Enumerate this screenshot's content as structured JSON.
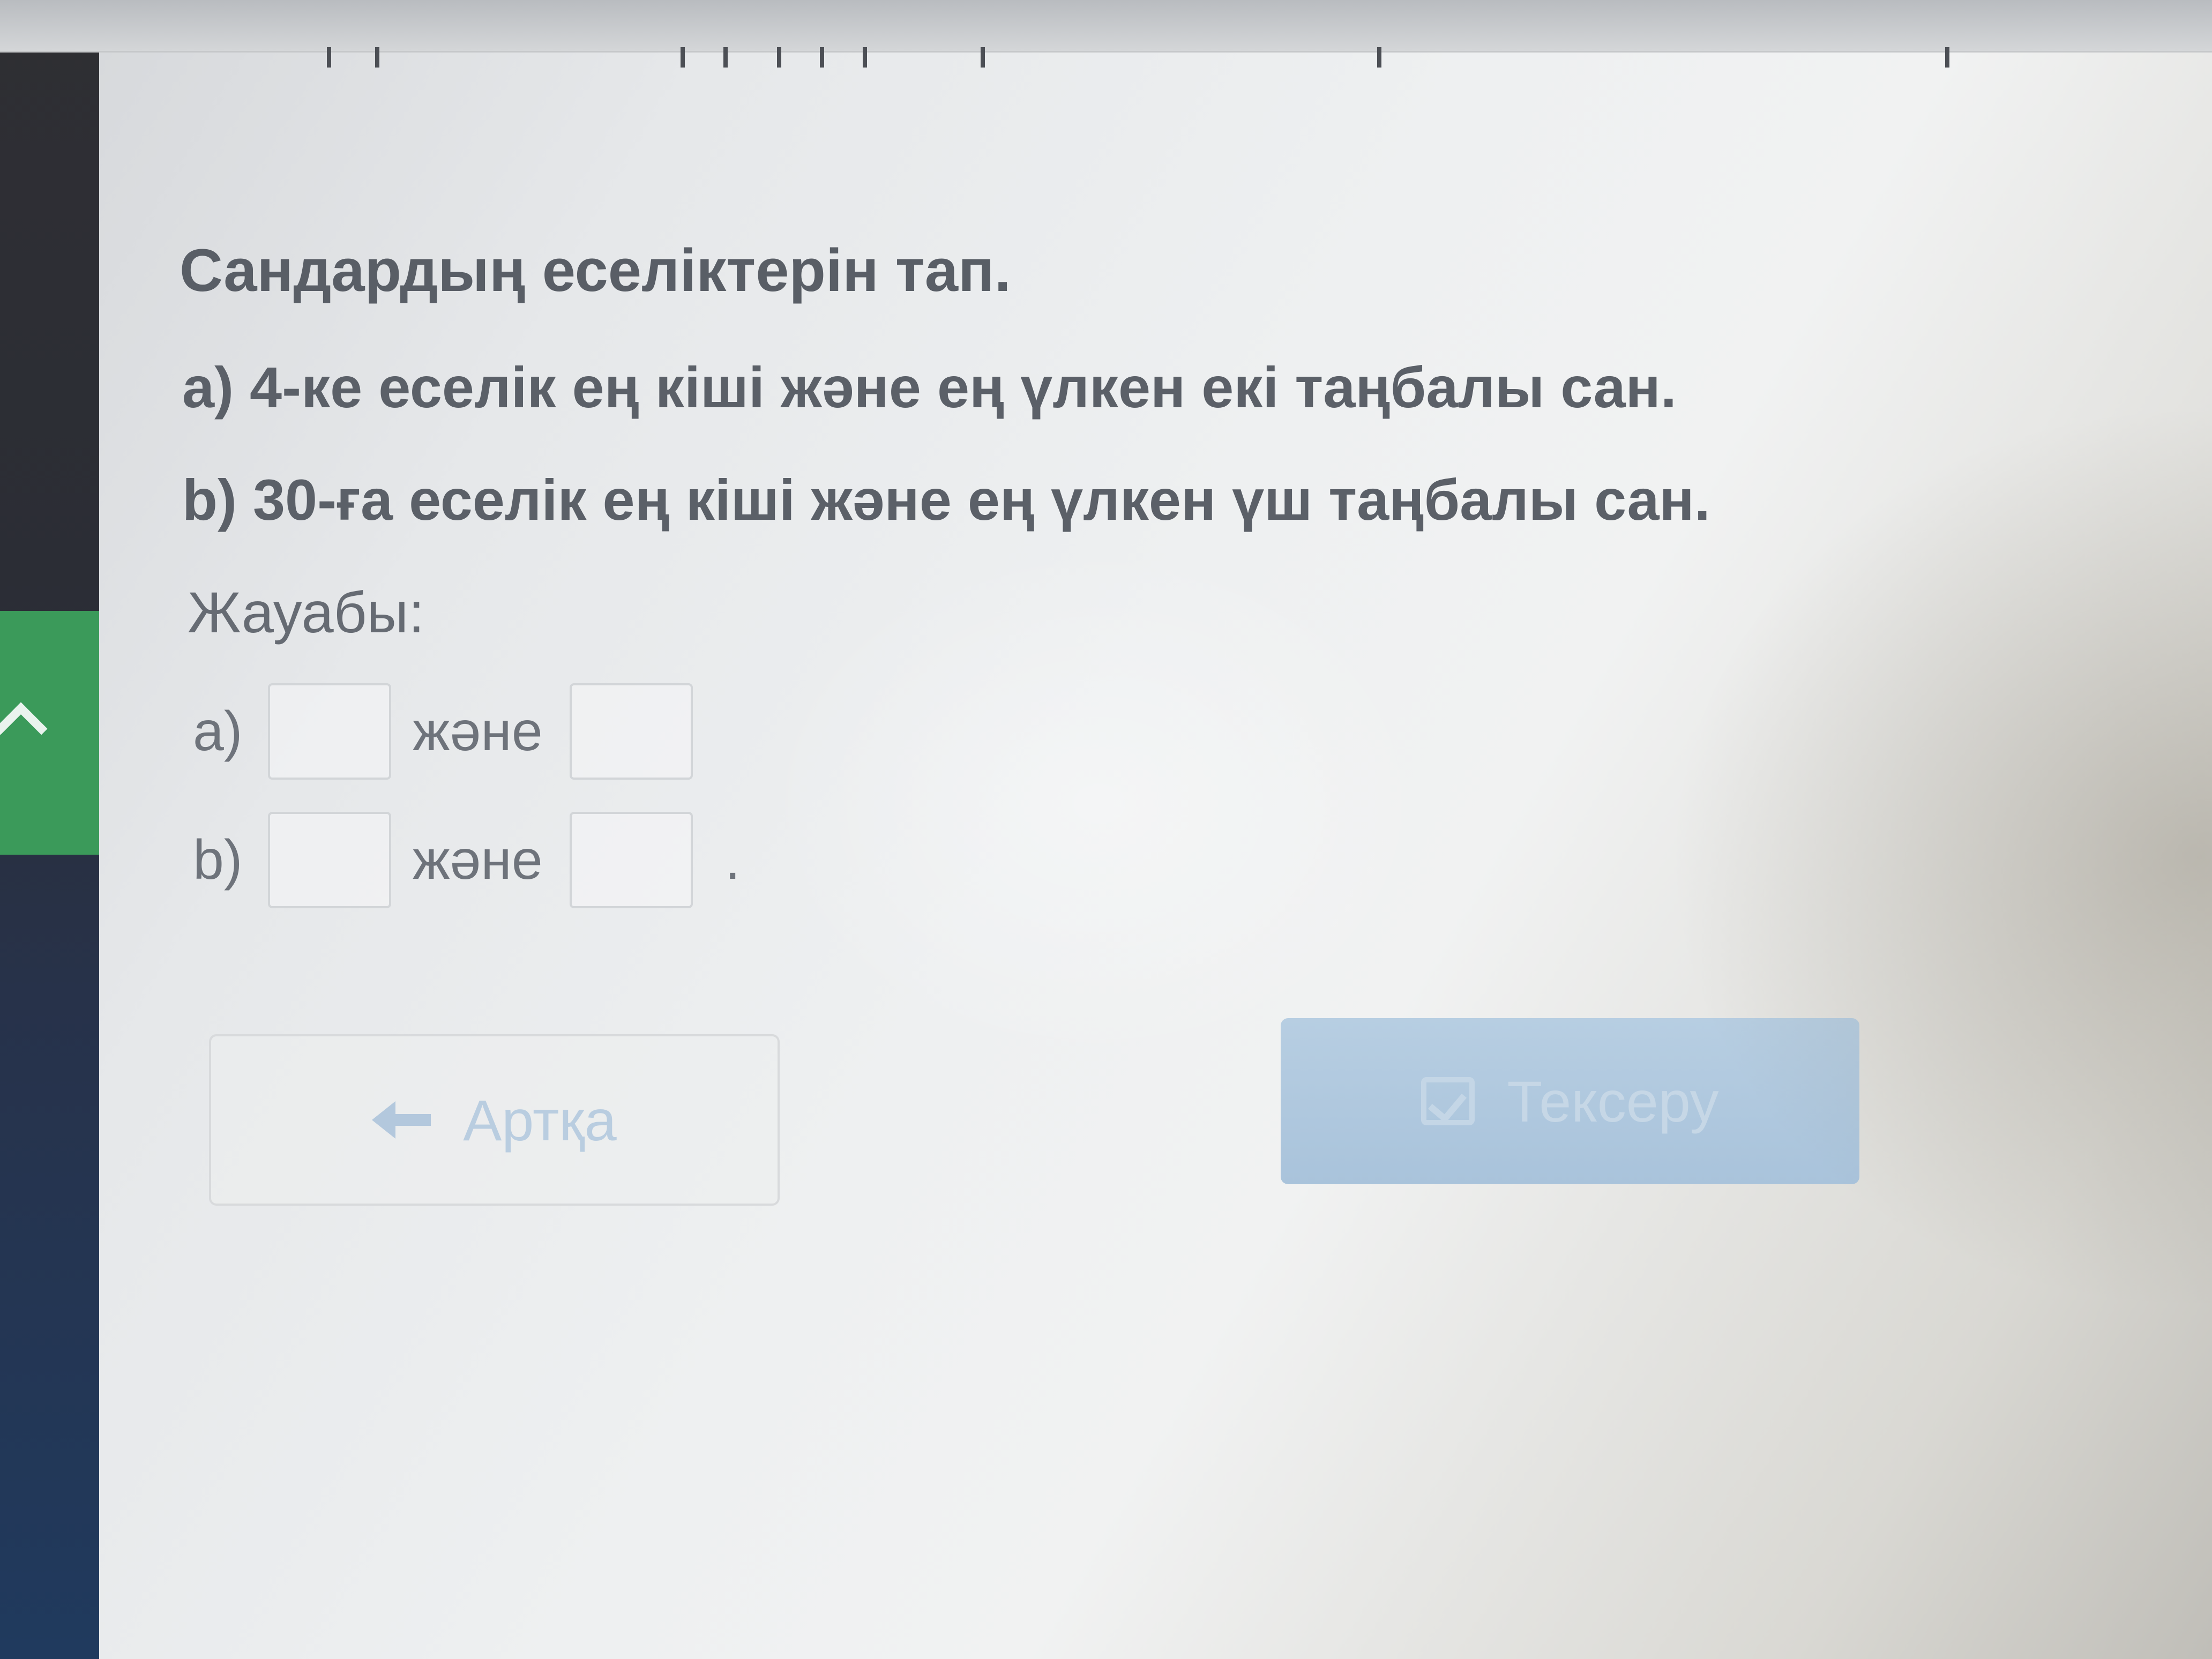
{
  "task": {
    "title": "Сандардың еселіктерін тап.",
    "question_a": "а) 4-ке еселік ең кіші және ең үлкен екі таңбалы сан.",
    "question_b": "b) 30-ға еселік ең кіші және ең үлкен үш таңбалы сан.",
    "answer_label": "Жауабы:"
  },
  "answers": {
    "row_a": {
      "label": "а)",
      "conjunction": "және",
      "value1": "",
      "value2": ""
    },
    "row_b": {
      "label": "b)",
      "conjunction": "және",
      "value1": "",
      "value2": "",
      "end": "."
    }
  },
  "buttons": {
    "back_label": "Артқа",
    "check_label": "Тексеру"
  },
  "icons": {
    "back": "arrow-left-icon",
    "check": "checkbox-icon",
    "sidebar_toggle": "chevron-up-icon"
  },
  "colors": {
    "sidebar_accent": "#3b9a5a",
    "check_button_bg": "#b0c8de",
    "text": "#5b6068"
  }
}
